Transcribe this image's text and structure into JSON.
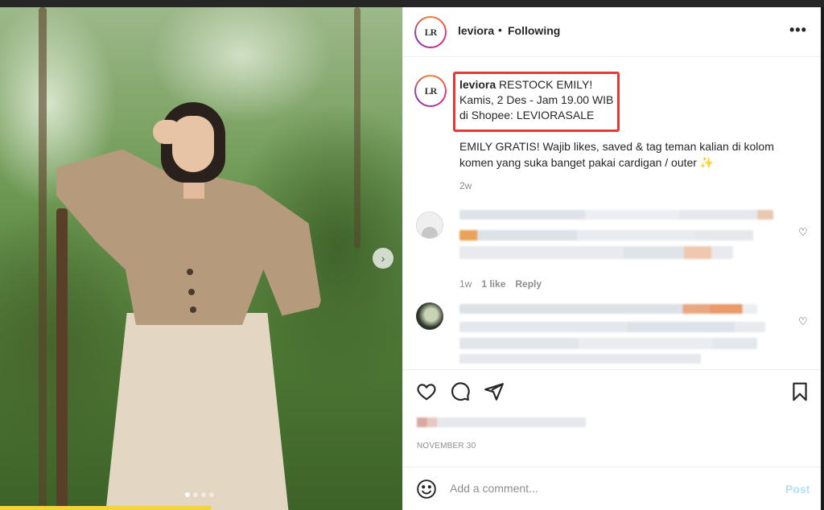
{
  "post": {
    "username": "leviora",
    "separator": "•",
    "follow_status": "Following",
    "more_icon": "more-horizontal-icon",
    "avatar_text": "LR"
  },
  "caption": {
    "username": "leviora",
    "line1": " RESTOCK EMILY!",
    "line2": "Kamis, 2 Des - Jam 19.00 WIB",
    "line3": "di Shopee: LEVIORASALE",
    "body": "EMILY GRATIS! Wajib likes, saved & tag teman kalian di kolom komen yang suka banget pakai cardigan / outer ✨",
    "time": "2w"
  },
  "comments": [
    {
      "time": "1w",
      "likes": "1 like",
      "reply": "Reply"
    },
    {
      "time": "",
      "likes": "",
      "reply": ""
    }
  ],
  "actions": {
    "like_icon": "heart-icon",
    "comment_icon": "comment-icon",
    "share_icon": "share-icon",
    "save_icon": "bookmark-icon"
  },
  "post_date": "NOVEMBER 30",
  "add_comment": {
    "placeholder": "Add a comment...",
    "post_label": "Post"
  },
  "colors": {
    "highlight": "#e53935",
    "post_button_disabled": "#b2dffc",
    "muted_text": "#8e8e8e"
  }
}
